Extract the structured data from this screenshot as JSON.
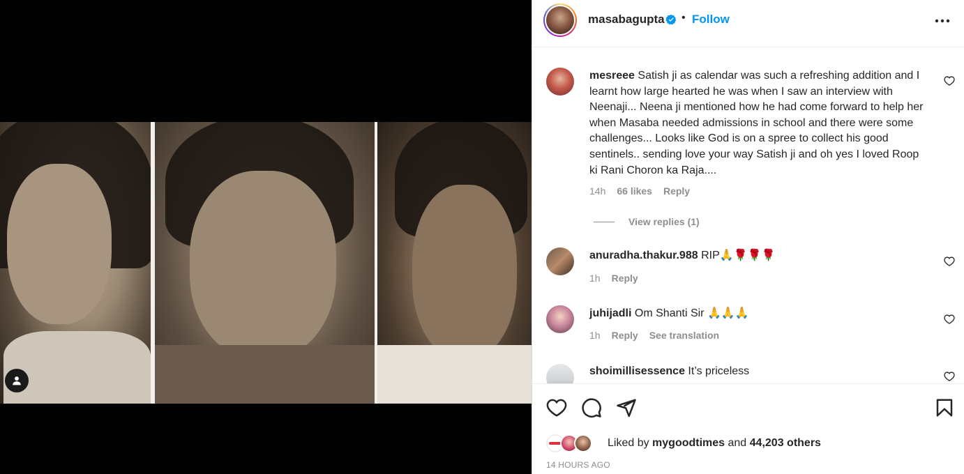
{
  "post": {
    "username": "masabagupta",
    "separator": "•",
    "follow_label": "Follow"
  },
  "comments": [
    {
      "user": "mesreee",
      "text": "Satish ji as calendar was such a refreshing addition and I learnt how large hearted he was when I saw an interview with Neenaji... Neena ji mentioned how he had come forward to help her when Masaba needed admissions in school and there were some challenges... Looks like God is on a spree to collect his good sentinels.. sending love your way Satish ji and oh yes I loved Roop ki Rani Choron ka Raja....",
      "time": "14h",
      "likes": "66 likes",
      "reply": "Reply",
      "view_replies": "View replies (1)"
    },
    {
      "user": "anuradha.thakur.988",
      "text": "RIP🙏🌹🌹🌹",
      "time": "1h",
      "reply": "Reply"
    },
    {
      "user": "juhijadli",
      "text": "Om Shanti Sir 🙏🙏🙏",
      "time": "1h",
      "reply": "Reply",
      "translate": "See translation"
    },
    {
      "user": "shoimillisessence",
      "text": "It’s priceless"
    }
  ],
  "likes": {
    "prefix": "Liked by ",
    "liker": "mygoodtimes",
    "middle": " and ",
    "count": "44,203 others"
  },
  "timestamp": "14 HOURS AGO",
  "icons": {
    "verified": "verified-badge-icon",
    "more": "more-options-icon",
    "heart": "heart-icon",
    "comment": "comment-icon",
    "share": "share-icon",
    "save": "bookmark-icon",
    "user_tag": "user-tag-icon"
  },
  "colors": {
    "follow": "#0095f6",
    "verified": "#0095f6",
    "muted": "#8e8e8e"
  }
}
